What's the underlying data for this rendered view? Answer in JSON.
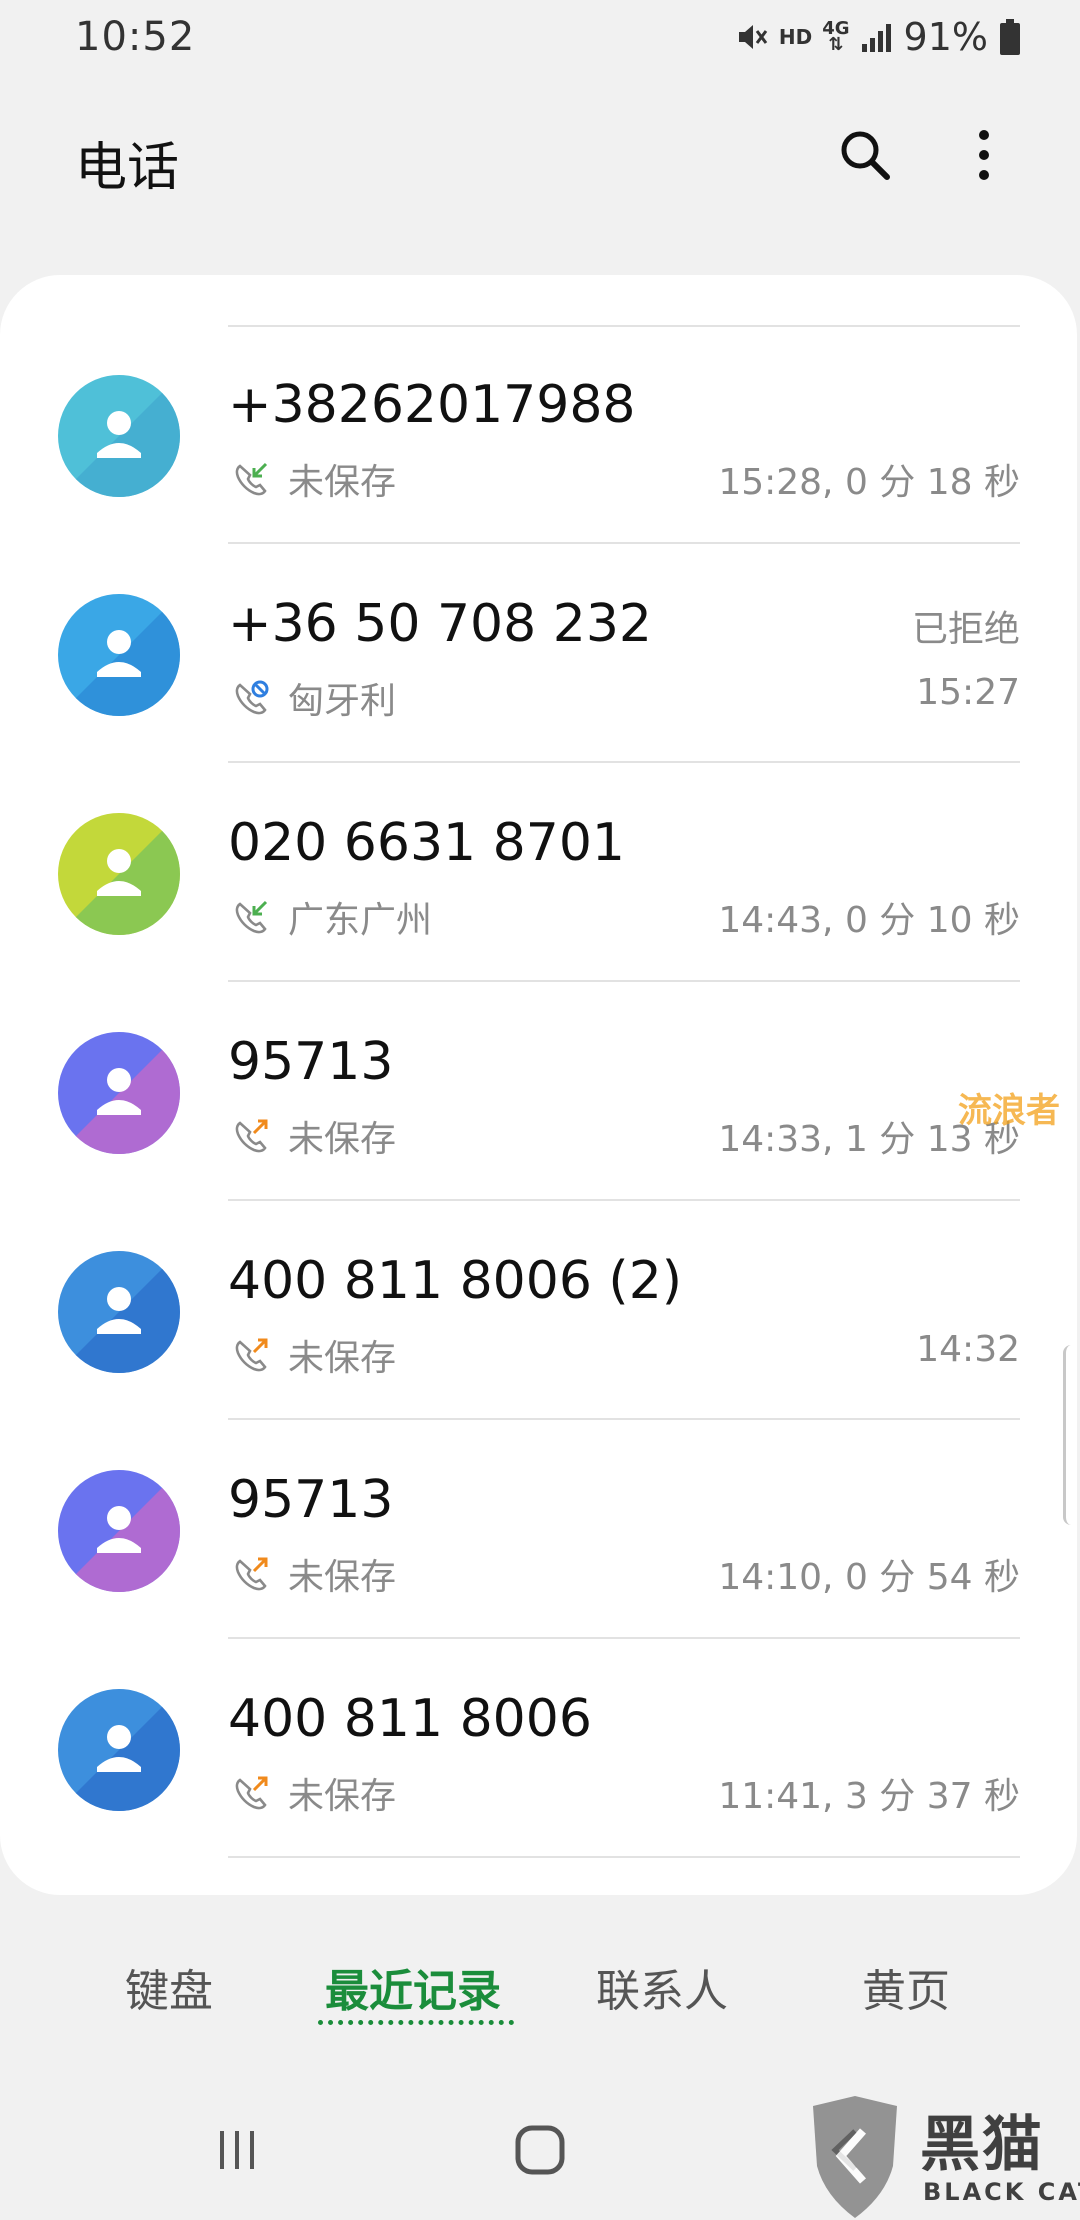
{
  "status_bar": {
    "time": "10:52",
    "hd": "HD",
    "network": "4G",
    "battery": "91%"
  },
  "header": {
    "title": "电话",
    "search_icon": "search-icon",
    "more_icon": "more-vert-icon"
  },
  "calls": [
    {
      "number": "+38262017988",
      "type": "incoming",
      "label": "未保存",
      "detail": "15:28, 0 分 18 秒",
      "status": "",
      "avatar_colors": [
        "#4fc0d8",
        "#41a9cf"
      ]
    },
    {
      "number": "+36 50 708 232",
      "type": "rejected",
      "label": "匈牙利",
      "detail": "15:27",
      "status": "已拒绝",
      "avatar_colors": [
        "#3aa7e6",
        "#2c8ad6"
      ]
    },
    {
      "number": "020 6631 8701",
      "type": "incoming",
      "label": "广东广州",
      "detail": "14:43, 0 分 10 秒",
      "status": "",
      "avatar_colors": [
        "#c3d83a",
        "#78c35b"
      ]
    },
    {
      "number": "95713",
      "type": "outgoing",
      "label": "未保存",
      "detail": "14:33, 1 分 13 秒",
      "status": "",
      "avatar_colors": [
        "#6a73ef",
        "#c768c8"
      ]
    },
    {
      "number": "400 811 8006 (2)",
      "type": "outgoing",
      "label": "未保存",
      "detail": "14:32",
      "status": "",
      "avatar_colors": [
        "#3d8fdd",
        "#2c6fc9"
      ]
    },
    {
      "number": "95713",
      "type": "outgoing",
      "label": "未保存",
      "detail": "14:10, 0 分 54 秒",
      "status": "",
      "avatar_colors": [
        "#6a73ef",
        "#c768c8"
      ]
    },
    {
      "number": "400 811 8006",
      "type": "outgoing",
      "label": "未保存",
      "detail": "11:41, 3 分 37 秒",
      "status": "",
      "avatar_colors": [
        "#3d8fdd",
        "#2c6fc9"
      ]
    }
  ],
  "tabs": [
    {
      "label": "键盘",
      "active": false
    },
    {
      "label": "最近记录",
      "active": true
    },
    {
      "label": "联系人",
      "active": false
    },
    {
      "label": "黄页",
      "active": false
    }
  ],
  "watermarks": {
    "text": "流浪者",
    "brand": "黑猫",
    "brand_en": "BLACK CAT"
  },
  "colors": {
    "accent": "#1b8d3b",
    "incoming": "#4caf50",
    "outgoing": "#f08a1c",
    "rejected": "#2f7fe0"
  }
}
